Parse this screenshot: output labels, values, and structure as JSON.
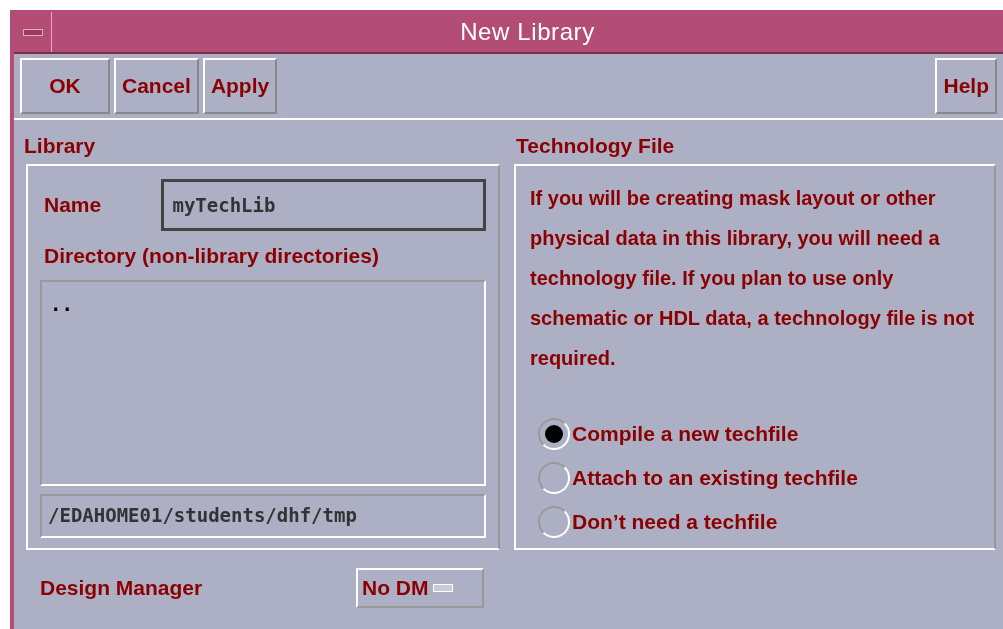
{
  "window": {
    "title": "New Library"
  },
  "buttons": [
    "OK",
    "Cancel",
    "Apply"
  ],
  "help_button": "Help",
  "library": {
    "heading": "Library",
    "name_label": "Name",
    "name_value": "myTechLib",
    "directory_label": "Directory (non-library directories)",
    "directory_items": [
      ".."
    ],
    "path": "/EDAHOME01/students/dhf/tmp"
  },
  "technology_file": {
    "heading": "Technology File",
    "description": "If you will be creating mask layout or other physical data in this library, you will need a technology file. If you plan to use only schematic or HDL data, a technology file is not required.",
    "options": [
      {
        "label": "Compile a new techfile",
        "selected": true
      },
      {
        "label": "Attach to an existing techfile",
        "selected": false
      },
      {
        "label": "Don’t need a techfile",
        "selected": false
      }
    ]
  },
  "design_manager": {
    "label": "Design Manager",
    "value": "No DM"
  }
}
